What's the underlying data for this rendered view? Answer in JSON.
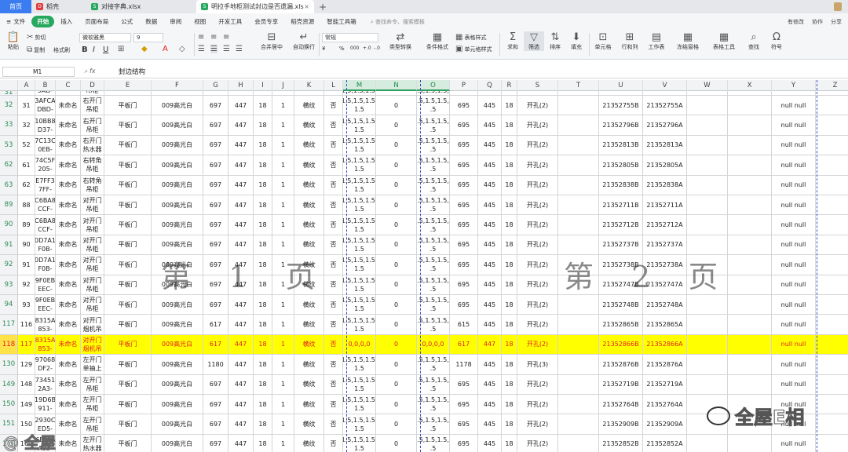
{
  "tabs": {
    "home": "首页",
    "t1": "稻壳",
    "t2": "对接字典.xlsx",
    "t3": "明拉手地柜测试封边是否遗漏.xls",
    "plus": "+"
  },
  "menu": {
    "file": "文件",
    "items": [
      "开始",
      "插入",
      "页面布局",
      "公式",
      "数据",
      "审阅",
      "视图",
      "开发工具",
      "会员专享",
      "稻壳资源",
      "智能工具箱"
    ],
    "search": "查找命令、搜索模板",
    "right": [
      "有修改",
      "协作",
      "分享"
    ]
  },
  "ribbon": {
    "paste": "粘贴",
    "cut": "剪切",
    "copy": "复制",
    "brush": "格式刷",
    "font": "微软雅黑",
    "size": "9",
    "bold": "B",
    "italic": "I",
    "underline": "U",
    "merge": "合并居中",
    "wrap": "自动换行",
    "numfmt": "常规",
    "currency": "¥",
    "percent": "%",
    "thousand": "000",
    "inc": "+.0",
    "dec": "-.0",
    "type_convert": "类型转换",
    "cond_format": "条件格式",
    "table_style": "表格样式",
    "cell_style": "单元格样式",
    "sum": "求和",
    "filter": "筛选",
    "sort": "排序",
    "fill": "填充",
    "cell": "单元格",
    "rowcol": "行和列",
    "sheet": "工作表",
    "freeze": "冻结窗格",
    "tools": "表格工具",
    "find": "查找",
    "symbol": "符号"
  },
  "formula": {
    "name": "M1",
    "content": "封边结构"
  },
  "columns": [
    "A",
    "B",
    "C",
    "D",
    "E",
    "F",
    "G",
    "H",
    "I",
    "J",
    "K",
    "L",
    "M",
    "N",
    "O",
    "P",
    "Q",
    "R",
    "S",
    "T",
    "U",
    "V",
    "W",
    "X",
    "Y",
    "Z"
  ],
  "rows": [
    {
      "rn": "31",
      "c": [
        "",
        "9AD-",
        "",
        "吊柜",
        "",
        "",
        "",
        "",
        "",
        "",
        "",
        "",
        "1.5,1.5,1.5,",
        "",
        "1.5,1.5,1.5,1",
        "",
        "",
        "",
        "",
        "",
        "",
        "",
        "",
        "",
        "",
        ""
      ]
    },
    {
      "rn": "32",
      "c": [
        "31",
        "3AFCA\nDBD-",
        "未命名",
        "右开门\n吊柜",
        "平板门",
        "009高光白",
        "697",
        "447",
        "18",
        "1",
        "横纹",
        "否",
        "1.5,1.5,1.5,\n1.5",
        "0",
        "1.5,1.5,1.5,1\n.5",
        "695",
        "445",
        "18",
        "开孔(2)",
        "",
        "21352755B",
        "21352755A",
        "",
        "",
        "null null",
        ""
      ]
    },
    {
      "rn": "33",
      "c": [
        "32",
        "10BB8\nD37-",
        "未命名",
        "右开门\n吊柜",
        "平板门",
        "009高光白",
        "697",
        "447",
        "18",
        "1",
        "横纹",
        "否",
        "1.5,1.5,1.5,\n1.5",
        "0",
        "1.5,1.5,1.5,1\n.5",
        "695",
        "445",
        "18",
        "开孔(2)",
        "",
        "21352796B",
        "21352796A",
        "",
        "",
        "null null",
        ""
      ]
    },
    {
      "rn": "53",
      "c": [
        "52",
        "7C13C\n0EB-",
        "未命名",
        "右开门\n热水器",
        "平板门",
        "009高光白",
        "697",
        "447",
        "18",
        "1",
        "横纹",
        "否",
        "1.5,1.5,1.5,\n1.5",
        "0",
        "1.5,1.5,1.5,1\n.5",
        "695",
        "445",
        "18",
        "开孔(2)",
        "",
        "21352813B",
        "21352813A",
        "",
        "",
        "null null",
        ""
      ]
    },
    {
      "rn": "62",
      "c": [
        "61",
        "74C5F\n205-",
        "未命名",
        "右转角\n吊柜",
        "平板门",
        "009高光白",
        "697",
        "447",
        "18",
        "1",
        "横纹",
        "否",
        "1.5,1.5,1.5,\n1.5",
        "0",
        "1.5,1.5,1.5,1\n.5",
        "695",
        "445",
        "18",
        "开孔(2)",
        "",
        "21352805B",
        "21352805A",
        "",
        "",
        "null null",
        ""
      ]
    },
    {
      "rn": "63",
      "c": [
        "62",
        "E7FF3\n7FF-",
        "未命名",
        "右转角\n吊柜",
        "平板门",
        "009高光白",
        "697",
        "447",
        "18",
        "1",
        "横纹",
        "否",
        "1.5,1.5,1.5,\n1.5",
        "0",
        "1.5,1.5,1.5,1\n.5",
        "695",
        "445",
        "18",
        "开孔(2)",
        "",
        "21352838B",
        "21352838A",
        "",
        "",
        "null null",
        ""
      ]
    },
    {
      "rn": "89",
      "c": [
        "88",
        "C6BA8\nCCF-",
        "未命名",
        "对开门\n吊柜",
        "平板门",
        "009高光白",
        "697",
        "447",
        "18",
        "1",
        "横纹",
        "否",
        "1.5,1.5,1.5,\n1.5",
        "0",
        "1.5,1.5,1.5,1\n.5",
        "695",
        "445",
        "18",
        "开孔(2)",
        "",
        "21352711B",
        "21352711A",
        "",
        "",
        "null null",
        ""
      ]
    },
    {
      "rn": "90",
      "c": [
        "89",
        "C6BA8\nCCF-",
        "未命名",
        "对开门\n吊柜",
        "平板门",
        "009高光白",
        "697",
        "447",
        "18",
        "1",
        "横纹",
        "否",
        "1.5,1.5,1.5,\n1.5",
        "0",
        "1.5,1.5,1.5,1\n.5",
        "695",
        "445",
        "18",
        "开孔(2)",
        "",
        "21352712B",
        "21352712A",
        "",
        "",
        "null null",
        ""
      ]
    },
    {
      "rn": "91",
      "c": [
        "90",
        "0D7A1\nF0B-",
        "未命名",
        "对开门\n吊柜",
        "平板门",
        "009高光白",
        "697",
        "447",
        "18",
        "1",
        "横纹",
        "否",
        "1.5,1.5,1.5,\n1.5",
        "0",
        "1.5,1.5,1.5,1\n.5",
        "695",
        "445",
        "18",
        "开孔(2)",
        "",
        "21352737B",
        "21352737A",
        "",
        "",
        "null null",
        ""
      ]
    },
    {
      "rn": "92",
      "c": [
        "91",
        "0D7A1\nF0B-",
        "未命名",
        "对开门\n吊柜",
        "平板门",
        "009高光白",
        "697",
        "447",
        "18",
        "1",
        "横纹",
        "否",
        "1.5,1.5,1.5,\n1.5",
        "0",
        "1.5,1.5,1.5,1\n.5",
        "695",
        "445",
        "18",
        "开孔(2)",
        "",
        "21352738B",
        "21352738A",
        "",
        "",
        "null null",
        ""
      ]
    },
    {
      "rn": "93",
      "c": [
        "92",
        "9F0EB\nEEC-",
        "未命名",
        "对开门\n吊柜",
        "平板门",
        "009高光白",
        "697",
        "447",
        "18",
        "1",
        "横纹",
        "否",
        "1.5,1.5,1.5,\n1.5",
        "0",
        "1.5,1.5,1.5,1\n.5",
        "695",
        "445",
        "18",
        "开孔(2)",
        "",
        "21352747B",
        "21352747A",
        "",
        "",
        "null null",
        ""
      ]
    },
    {
      "rn": "94",
      "c": [
        "93",
        "9F0EB\nEEC-",
        "未命名",
        "对开门\n吊柜",
        "平板门",
        "009高光白",
        "697",
        "447",
        "18",
        "1",
        "横纹",
        "否",
        "1.5,1.5,1.5,\n1.5",
        "0",
        "1.5,1.5,1.5,1\n.5",
        "695",
        "445",
        "18",
        "开孔(2)",
        "",
        "21352748B",
        "21352748A",
        "",
        "",
        "null null",
        ""
      ]
    },
    {
      "rn": "117",
      "c": [
        "116",
        "8315A\n853-",
        "未命名",
        "对开门\n烟机吊",
        "平板门",
        "009高光白",
        "617",
        "447",
        "18",
        "1",
        "横纹",
        "否",
        "1.5,1.5,1.5,\n1.5",
        "0",
        "1.5,1.5,1.5,1\n.5",
        "615",
        "445",
        "18",
        "开孔(2)",
        "",
        "21352865B",
        "21352865A",
        "",
        "",
        "null null",
        ""
      ]
    },
    {
      "rn": "118",
      "hl": true,
      "c": [
        "117",
        "8315A\n853-",
        "未命名",
        "对开门\n烟机吊",
        "平板门",
        "009高光白",
        "617",
        "447",
        "18",
        "1",
        "横纹",
        "否",
        "0,0,0,0",
        "0",
        "0,0,0,0",
        "617",
        "447",
        "18",
        "开孔(2)",
        "",
        "21352866B",
        "21352866A",
        "",
        "",
        "null null",
        ""
      ]
    },
    {
      "rn": "130",
      "c": [
        "129",
        "97068\nDF2-",
        "未命名",
        "左开门\n单抽上",
        "平板门",
        "009高光白",
        "1180",
        "447",
        "18",
        "1",
        "横纹",
        "否",
        "1.5,1.5,1.5,\n1.5",
        "0",
        "1.5,1.5,1.5,1\n.5",
        "1178",
        "445",
        "18",
        "开孔(3)",
        "",
        "21352876B",
        "21352876A",
        "",
        "",
        "null null",
        ""
      ]
    },
    {
      "rn": "149",
      "c": [
        "148",
        "73451\n2A3-",
        "未命名",
        "左开门\n吊柜",
        "平板门",
        "009高光白",
        "697",
        "447",
        "18",
        "1",
        "横纹",
        "否",
        "1.5,1.5,1.5,\n1.5",
        "0",
        "1.5,1.5,1.5,1\n.5",
        "695",
        "445",
        "18",
        "开孔(2)",
        "",
        "21352719B",
        "21352719A",
        "",
        "",
        "null null",
        ""
      ]
    },
    {
      "rn": "150",
      "c": [
        "149",
        "19D6B\n911-",
        "未命名",
        "左开门\n吊柜",
        "平板门",
        "009高光白",
        "697",
        "447",
        "18",
        "1",
        "横纹",
        "否",
        "1.5,1.5,1.5,\n1.5",
        "0",
        "1.5,1.5,1.5,1\n.5",
        "695",
        "445",
        "18",
        "开孔(2)",
        "",
        "21352764B",
        "21352764A",
        "",
        "",
        "null null",
        ""
      ]
    },
    {
      "rn": "151",
      "c": [
        "150",
        "2930C\nED5-",
        "未命名",
        "左开门\n吊柜",
        "平板门",
        "009高光白",
        "697",
        "447",
        "18",
        "1",
        "横纹",
        "否",
        "1.5,1.5,1.5,\n1.5",
        "0",
        "1.5,1.5,1.5,1\n.5",
        "695",
        "445",
        "18",
        "开孔(2)",
        "",
        "21352909B",
        "21352909A",
        "",
        "",
        "null null",
        ""
      ]
    },
    {
      "rn": "170",
      "c": [
        "169",
        "6EF9F\nA03-",
        "未命名",
        "左开门\n热水器",
        "平板门",
        "009高光白",
        "697",
        "447",
        "18",
        "1",
        "横纹",
        "否",
        "1.5,1.5,1.5,\n1.5",
        "0",
        "1.5,1.5,1.5,1\n.5",
        "695",
        "445",
        "18",
        "开孔(2)",
        "",
        "21352852B",
        "21352852A",
        "",
        "",
        "null null",
        ""
      ]
    }
  ],
  "watermark": {
    "page1": "第 1 页",
    "page2": "第 2 页"
  },
  "brand": {
    "main": "全屋E相",
    "corner": "@ 全屋"
  },
  "colors": {
    "accent": "#27a85f",
    "highlight": "#ffff00",
    "highlight_text": "#e32020",
    "pagebreak": "#3b4cc0"
  }
}
